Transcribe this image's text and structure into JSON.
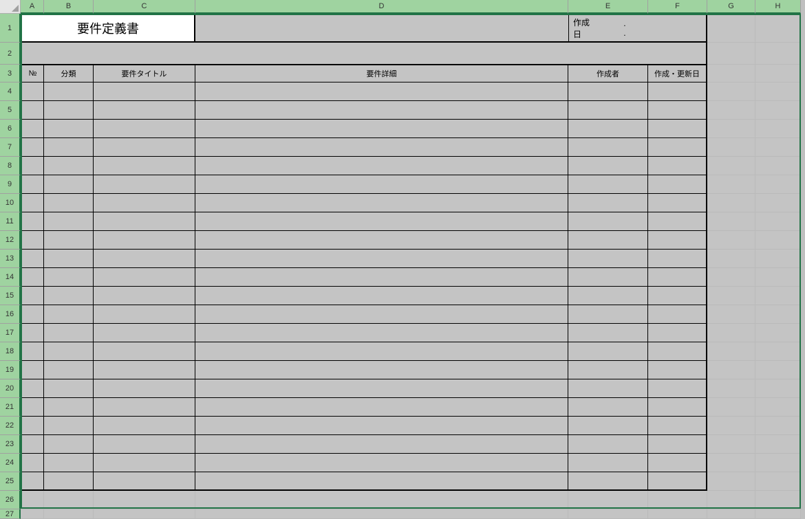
{
  "columns": [
    "A",
    "B",
    "C",
    "D",
    "E",
    "F",
    "G",
    "H"
  ],
  "rows": [
    "1",
    "2",
    "3",
    "4",
    "5",
    "6",
    "7",
    "8",
    "9",
    "10",
    "11",
    "12",
    "13",
    "14",
    "15",
    "16",
    "17",
    "18",
    "19",
    "20",
    "21",
    "22",
    "23",
    "24",
    "25",
    "26",
    "27"
  ],
  "title": "要件定義書",
  "date_label": "作成日",
  "date_value": ".          .",
  "headers": {
    "no": "№",
    "category": "分類",
    "req_title": "要件タイトル",
    "req_detail": "要件詳細",
    "author": "作成者",
    "created_updated": "作成・更新日"
  },
  "data_rows": 22
}
